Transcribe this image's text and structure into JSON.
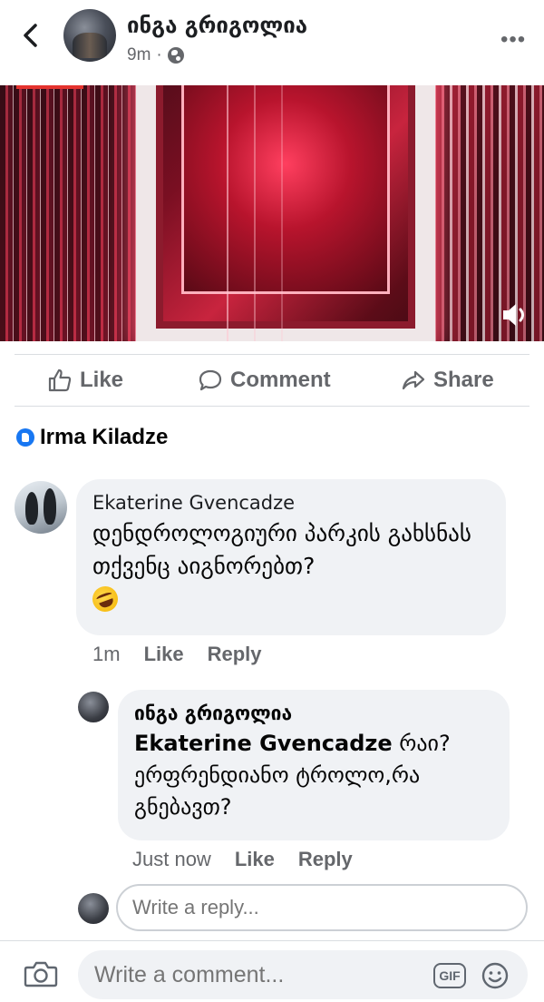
{
  "header": {
    "name": "ინგა გრიგოლია",
    "time": "9m",
    "separator": "·",
    "more": "•••"
  },
  "actions": {
    "like": "Like",
    "comment": "Comment",
    "share": "Share"
  },
  "top_fan": {
    "name": "Irma  Kiladze"
  },
  "comments": [
    {
      "author": "Ekaterine Gvencadze",
      "text": "დენდროლოგიური პარკის გახსნას თქვენც აიგნორებთ?",
      "emoji": "rolling-on-floor-laughing-icon",
      "time": "1m",
      "like": "Like",
      "reply": "Reply"
    },
    {
      "author": "ინგა გრიგოლია",
      "mention": "Ekaterine Gvencadze",
      "text": " რაი? ერფრენდიანო ტროლო,რა გნებავთ?",
      "time": "Just now",
      "like": "Like",
      "reply": "Reply"
    }
  ],
  "reply_input": {
    "placeholder": "Write a reply..."
  },
  "bottom_bar": {
    "placeholder": "Write a comment...",
    "gif": "GIF"
  },
  "colors": {
    "accent": "#1877f2",
    "secondary_text": "#65676b",
    "bubble": "#f0f2f5",
    "video_progress": "#e4332e"
  }
}
